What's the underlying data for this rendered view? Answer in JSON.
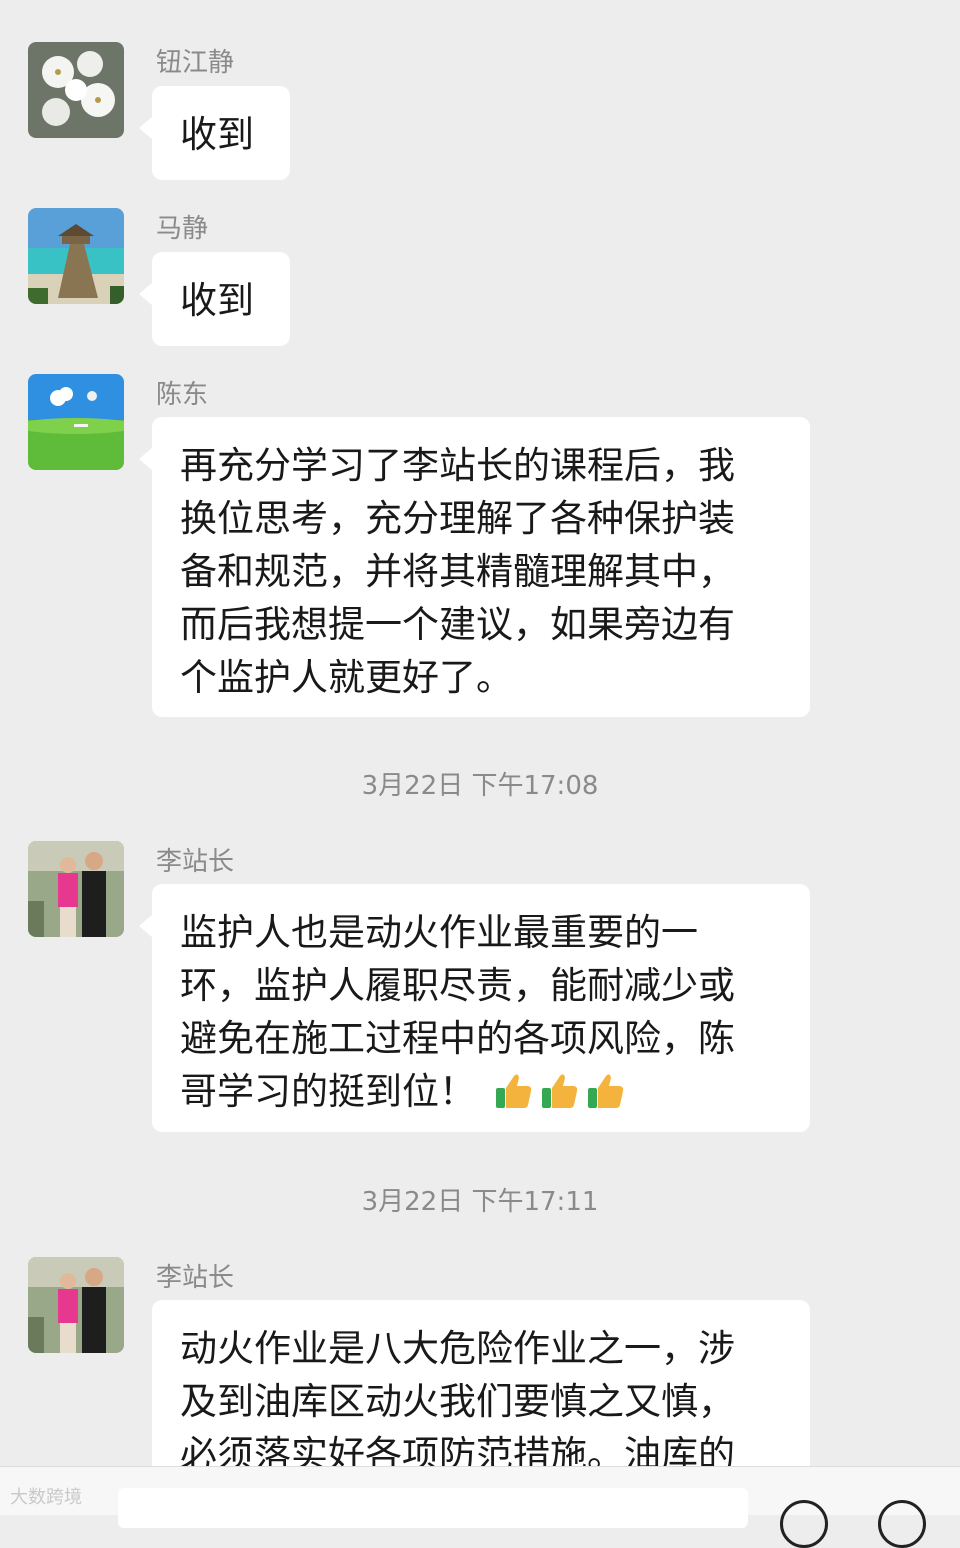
{
  "messages": [
    {
      "sender": "钮江静",
      "lines": [
        "收到"
      ]
    },
    {
      "sender": "马静",
      "lines": [
        "收到"
      ]
    },
    {
      "sender": "陈东",
      "lines": [
        "再充分学习了李站长的课程后，我",
        "换位思考，充分理解了各种保护装",
        "备和规范，并将其精髓理解其中，",
        "而后我想提一个建议，如果旁边有",
        "个监护人就更好了。"
      ]
    },
    {
      "sender": "李站长",
      "lines": [
        "监护人也是动火作业最重要的一",
        "环，监护人履职尽责，能耐减少或",
        "避免在施工过程中的各项风险，陈",
        "哥学习的挺到位！"
      ]
    },
    {
      "sender": "李站长",
      "lines": [
        "动火作业是八大危险作业之一，涉",
        "及到油库区动火我们要慎之又慎，",
        "必须落实好各项防范措施。油库的"
      ]
    }
  ],
  "timestamps": [
    "3月22日 下午17:08",
    "3月22日 下午17:11"
  ],
  "watermark": "大数跨境",
  "colors": {
    "background": "#ededed",
    "bubble": "#ffffff",
    "meta_text": "#8a8a8a"
  },
  "icons": [
    "thumbs-up-icon",
    "thumbs-up-icon",
    "thumbs-up-icon"
  ]
}
